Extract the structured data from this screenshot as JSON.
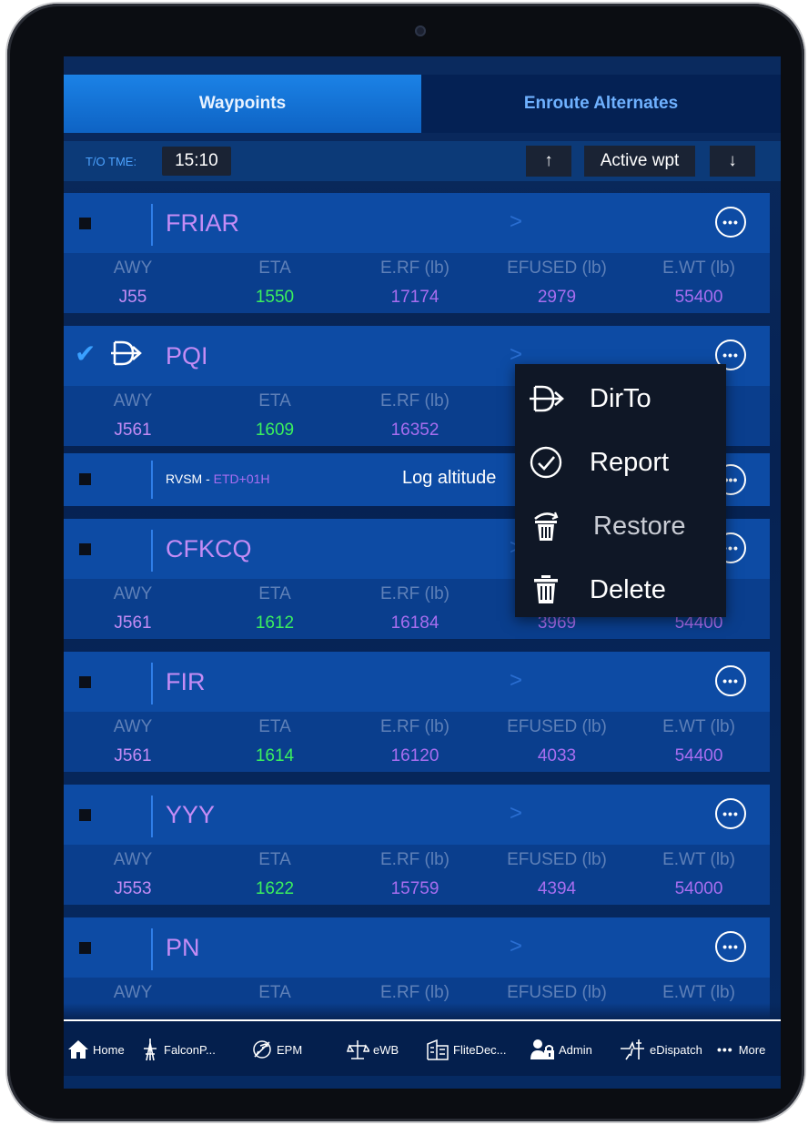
{
  "tabs": [
    {
      "label": "Waypoints"
    },
    {
      "label": "Enroute Alternates"
    }
  ],
  "toolbar": {
    "to_label": "T/O TME:",
    "to_time": "15:10",
    "up_glyph": "↑",
    "active_label": "Active wpt",
    "down_glyph": "↓"
  },
  "col_labels": {
    "awy": "AWY",
    "eta": "ETA",
    "erf": "E.RF (lb)",
    "efused": "EFUSED (lb)",
    "ewt": "E.WT (lb)"
  },
  "partial_labels": {
    "efused_clip": "El",
    "ewt_clip": "b)"
  },
  "waypoints": [
    {
      "name": "FRIAR",
      "awy": "J55",
      "eta": "1550",
      "erf": "17174",
      "efused": "2979",
      "ewt": "55400",
      "checked": false
    },
    {
      "name": "PQI",
      "awy": "J561",
      "eta": "1609",
      "erf": "16352",
      "efused": "",
      "ewt": "",
      "checked": true
    },
    {
      "name": "CFKCQ",
      "awy": "J561",
      "eta": "1612",
      "erf": "16184",
      "efused": "3969",
      "ewt": "54400",
      "checked": false
    },
    {
      "name": "FIR",
      "awy": "J561",
      "eta": "1614",
      "erf": "16120",
      "efused": "4033",
      "ewt": "54400",
      "checked": false
    },
    {
      "name": "YYY",
      "awy": "J553",
      "eta": "1622",
      "erf": "15759",
      "efused": "4394",
      "ewt": "54000",
      "checked": false
    },
    {
      "name": "PN",
      "awy": "",
      "eta": "",
      "erf": "",
      "efused": "",
      "ewt": "",
      "checked": false
    }
  ],
  "rvsm": {
    "prefix": "RVSM - ",
    "etd": "ETD+01H",
    "log": "Log altitude"
  },
  "menu": {
    "items": [
      {
        "label": "DirTo",
        "icon": "dirto-icon"
      },
      {
        "label": "Report",
        "icon": "check-circle-icon"
      },
      {
        "label": "Restore",
        "icon": "restore-trash-icon"
      },
      {
        "label": "Delete",
        "icon": "trash-icon"
      }
    ]
  },
  "bottom_nav": [
    {
      "label": "Home",
      "icon": "home-icon"
    },
    {
      "label": "FalconP...",
      "icon": "tower-icon"
    },
    {
      "label": "EPM",
      "icon": "plane-circle-icon"
    },
    {
      "label": "eWB",
      "icon": "balance-icon"
    },
    {
      "label": "FliteDec...",
      "icon": "building-icon"
    },
    {
      "label": "Admin",
      "icon": "admin-icon"
    },
    {
      "label": "eDispatch",
      "icon": "dispatch-icon"
    },
    {
      "label": "More",
      "icon": "more-dots-icon"
    }
  ],
  "colors": {
    "accent": "#1b82e6",
    "waypoint_name": "#c48cf5",
    "eta": "#3bf05e"
  }
}
